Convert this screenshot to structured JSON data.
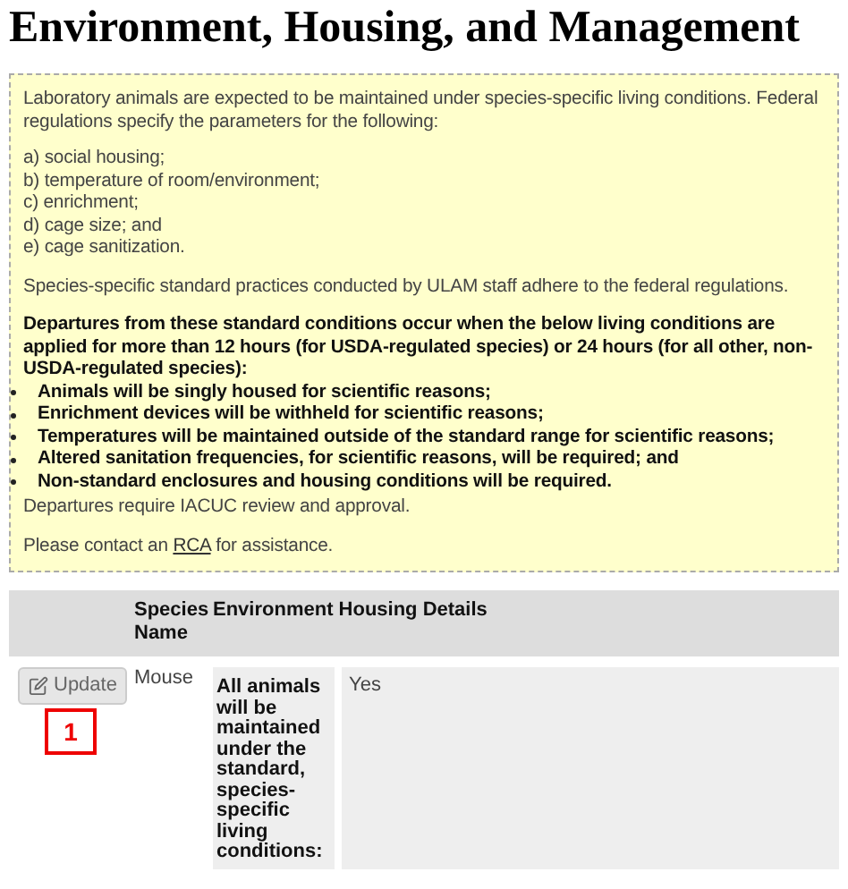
{
  "page_title": "Environment, Housing, and Management",
  "info_box": {
    "intro": "Laboratory animals are expected to be maintained under species-specific living conditions. Federal regulations specify the parameters for the following:",
    "criteria": [
      "a) social housing;",
      "b) temperature of room/environment;",
      "c) enrichment;",
      "d) cage size; and",
      "e) cage sanitization."
    ],
    "practice": "Species-specific standard practices conducted by ULAM staff adhere to the federal regulations.",
    "departures_heading": "Departures from these standard conditions occur when the below living conditions are applied for more than 12 hours (for USDA-regulated species) or 24 hours (for all other, non-USDA-regulated species):",
    "departure_conditions": [
      "Animals will be singly housed for scientific reasons;",
      "Enrichment devices will be withheld for scientific reasons;",
      "Temperatures will be maintained outside of the standard range for scientific reasons;",
      "Altered sanitation frequencies, for scientific reasons, will be required; and",
      "Non-standard enclosures and housing conditions will be required."
    ],
    "approval_note": "Departures require IACUC review and approval.",
    "contact": {
      "before": "Please contact an ",
      "link": "RCA",
      "after": " for assistance."
    }
  },
  "table": {
    "columns": [
      "Species Name",
      "Environment Housing Details"
    ],
    "rows": [
      {
        "button": "Update",
        "callout": "1",
        "species": "Mouse",
        "details": [
          {
            "label": "All animals will be maintained under the standard, species-specific living conditions:",
            "value": "Yes"
          }
        ]
      }
    ]
  }
}
